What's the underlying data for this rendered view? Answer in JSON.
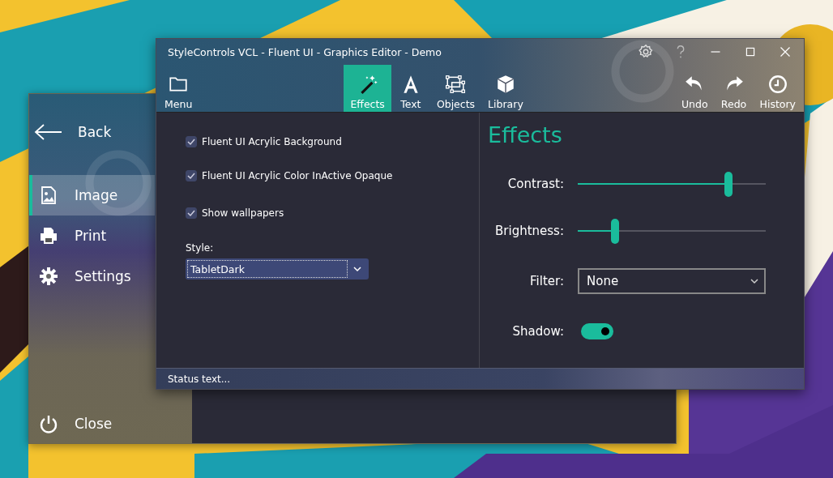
{
  "back_window": {
    "nav": {
      "back": "Back",
      "items": [
        {
          "label": "Image",
          "selected": true
        },
        {
          "label": "Print",
          "selected": false
        },
        {
          "label": "Settings",
          "selected": false
        }
      ],
      "close": "Close"
    }
  },
  "window": {
    "title": "StyleControls VCL - Fluent UI - Graphics Editor - Demo"
  },
  "toolbar": {
    "left": [
      {
        "label": "Menu",
        "selected": false
      }
    ],
    "tools": [
      {
        "label": "Effects",
        "selected": true
      },
      {
        "label": "Text",
        "selected": false
      },
      {
        "label": "Objects",
        "selected": false
      },
      {
        "label": "Library",
        "selected": false
      }
    ],
    "right": [
      {
        "label": "Undo",
        "selected": false
      },
      {
        "label": "Redo",
        "selected": false
      },
      {
        "label": "History",
        "selected": false
      }
    ]
  },
  "options": [
    {
      "label": "Fluent UI Acrylic Background",
      "checked": true
    },
    {
      "label": "Fluent UI Acrylic Color InActive Opaque",
      "checked": true
    },
    {
      "label": "Show wallpapers",
      "checked": true
    }
  ],
  "style": {
    "label": "Style:",
    "value": "TabletDark"
  },
  "effects": {
    "title": "Effects",
    "sliders": [
      {
        "label": "Contrast:",
        "level": 0.8
      },
      {
        "label": "Brightness:",
        "level": 0.2
      }
    ],
    "filter": {
      "label": "Filter:",
      "value": "None"
    },
    "shadow": {
      "label": "Shadow:",
      "on": true
    }
  },
  "status_bar": {
    "text": "Status text..."
  }
}
